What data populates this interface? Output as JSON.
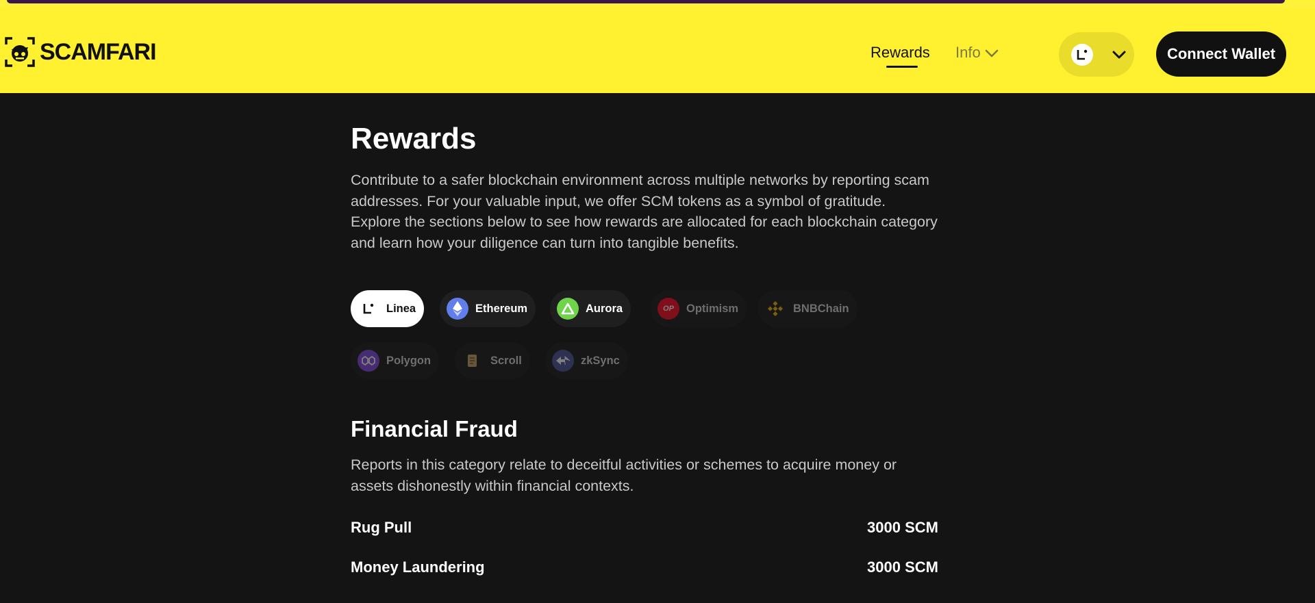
{
  "header": {
    "brand": "SCAMFARI",
    "nav": {
      "rewards": "Rewards",
      "info": "Info"
    },
    "network_icon": "linea-icon",
    "connect_label": "Connect Wallet"
  },
  "main": {
    "title": "Rewards",
    "intro": "Contribute to a safer blockchain environment across multiple networks by reporting scam addresses. For your valuable input, we offer SCM tokens as a symbol of gratitude. Explore the sections below to see how rewards are allocated for each blockchain category and learn how your diligence can turn into tangible benefits.",
    "networks": [
      {
        "label": "Linea",
        "state": "active",
        "icon": "linea-icon",
        "color": "#ffffff"
      },
      {
        "label": "Ethereum",
        "state": "enabled",
        "icon": "ethereum-icon",
        "color": "#627eea"
      },
      {
        "label": "Aurora",
        "state": "enabled",
        "icon": "aurora-icon",
        "color": "#70d44b"
      },
      {
        "label": "Optimism",
        "state": "disabled",
        "icon": "optimism-icon",
        "color": "#ff0420"
      },
      {
        "label": "BNBChain",
        "state": "disabled",
        "icon": "bnb-icon",
        "color": "#f0b90b"
      },
      {
        "label": "Polygon",
        "state": "disabled",
        "icon": "polygon-icon",
        "color": "#8247e5"
      },
      {
        "label": "Scroll",
        "state": "disabled",
        "icon": "scroll-icon",
        "color": "#c9a36a"
      },
      {
        "label": "zkSync",
        "state": "disabled",
        "icon": "zksync-icon",
        "color": "#4e529a"
      }
    ],
    "section": {
      "title": "Financial Fraud",
      "description": "Reports in this category relate to deceitful activities or schemes to acquire money or assets dishonestly within financial contexts.",
      "rows": [
        {
          "label": "Rug Pull",
          "value": "3000 SCM"
        },
        {
          "label": "Money Laundering",
          "value": "3000 SCM"
        }
      ]
    }
  }
}
